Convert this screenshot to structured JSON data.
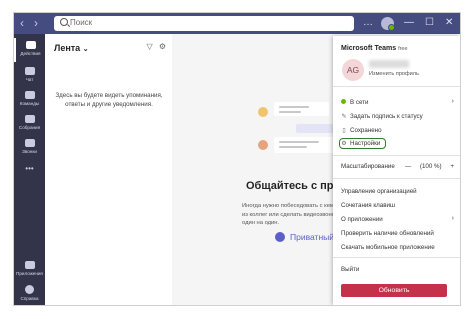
{
  "titlebar": {
    "search_placeholder": "Поиск",
    "back_icon": "chevron-left-icon",
    "forward_icon": "chevron-right-icon",
    "more": "…",
    "minimize": "—",
    "maximize": "☐",
    "close": "✕"
  },
  "rail": {
    "items": [
      {
        "label": "Действия",
        "icon": "bell-icon"
      },
      {
        "label": "Чат",
        "icon": "chat-icon"
      },
      {
        "label": "Команды",
        "icon": "teams-icon"
      },
      {
        "label": "Собрания",
        "icon": "calendar-icon"
      },
      {
        "label": "Звонки",
        "icon": "phone-icon"
      },
      {
        "label": "•••",
        "icon": "more-icon"
      },
      {
        "label": "Приложения",
        "icon": "apps-icon"
      },
      {
        "label": "Справка",
        "icon": "help-icon"
      }
    ]
  },
  "feed": {
    "title": "Лента",
    "empty_text": "Здесь вы будете видеть упоминания, ответы и другие уведомления."
  },
  "main": {
    "title": "Общайтесь с при",
    "subtitle": "Иногда нужно побеседовать с кем-то из коллег или сделать видеозвонок один на один.",
    "private_chat": "Приватный чат"
  },
  "menu": {
    "app_name": "Microsoft Teams",
    "app_tier": "free",
    "avatar_initials": "AG",
    "change_profile": "Изменить профиль",
    "status": "В сети",
    "set_status": "Задать подпись к статусу",
    "saved": "Сохранено",
    "settings": "Настройки",
    "zoom_label": "Масштабирование",
    "zoom_minus": "—",
    "zoom_value": "(100 %)",
    "zoom_plus": "+",
    "manage_org": "Управление организацией",
    "shortcuts": "Сочетания клавиш",
    "about": "О приложении",
    "check_updates": "Проверить наличие обновлений",
    "download_mobile": "Скачать мобильное приложение",
    "sign_out": "Выйти",
    "update_button": "Обновить"
  },
  "colors": {
    "titlebar": "#454c7f",
    "rail": "#33344a",
    "accent": "#5b5fc7",
    "update_button": "#c4314b",
    "settings_highlight": "#2e7d32",
    "online": "#6bb700"
  }
}
